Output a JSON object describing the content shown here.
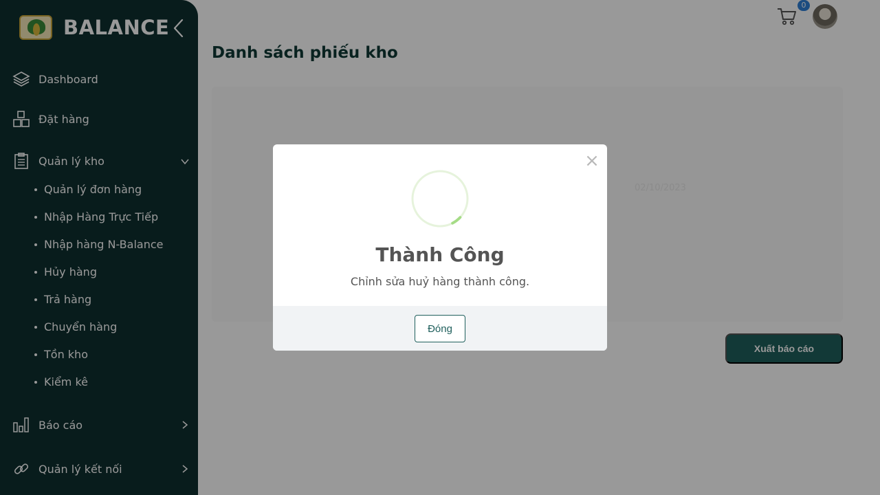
{
  "brand": {
    "name": "BALANCE"
  },
  "sidebar": {
    "items": [
      {
        "label": "Dashboard",
        "icon": "layers-icon"
      },
      {
        "label": "Đặt hàng",
        "icon": "boxes-icon"
      },
      {
        "label": "Quản lý kho",
        "icon": "clipboard-icon",
        "expanded": true
      },
      {
        "label": "Báo cáo",
        "icon": "bar-chart-icon"
      },
      {
        "label": "Quản lý kết nối",
        "icon": "link-icon"
      }
    ],
    "warehouse_subitems": [
      "Quản lý đơn hàng",
      "Nhập Hàng Trực Tiếp",
      "Nhập hàng N-Balance",
      "Hủy hàng",
      "Trả hàng",
      "Chuyển hàng",
      "Tồn kho",
      "Kiểm kê"
    ]
  },
  "header": {
    "cart_count": "0"
  },
  "main": {
    "title": "Danh sách phiếu kho",
    "export_label": "Xuất báo cáo",
    "faint_date": "02/10/2023"
  },
  "modal": {
    "title": "Thành Công",
    "message": "Chỉnh sửa huỷ hàng thành công.",
    "close_label": "Đóng",
    "close_icon": "×"
  },
  "colors": {
    "sidebar_bg": "#0e2f2f",
    "accent": "#1f5f5c",
    "success_ring": "#a5dc86",
    "badge": "#2f7fd6"
  }
}
